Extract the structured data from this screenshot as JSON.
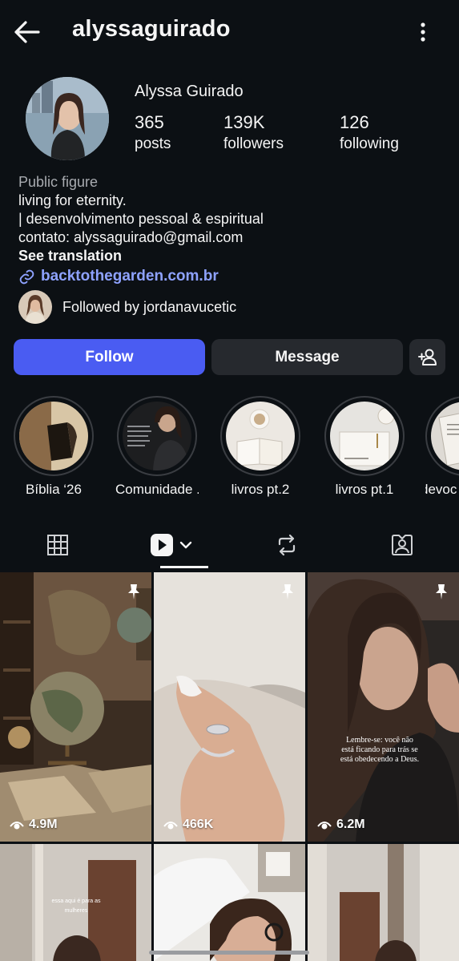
{
  "header": {
    "username": "alyssaguirado",
    "back_icon": "arrow-left-icon",
    "more_icon": "more-vertical-icon"
  },
  "profile": {
    "display_name": "Alyssa Guirado",
    "stats": [
      {
        "value": "365",
        "label": "posts"
      },
      {
        "value": "139K",
        "label": "followers"
      },
      {
        "value": "126",
        "label": "following"
      }
    ],
    "category": "Public figure",
    "bio_line1": "living for eternity.",
    "bio_line2": "| desenvolvimento pessoal & espiritual",
    "bio_line3": "contato: alyssaguirado@gmail.com",
    "see_translation": "See translation",
    "link": "backtothegarden.com.br",
    "followed_by": "Followed by jordanavucetic"
  },
  "actions": {
    "follow": "Follow",
    "message": "Message",
    "add_icon": "person-add-icon"
  },
  "highlights": [
    {
      "label": "Bíblia ‘26"
    },
    {
      "label": "Comunidade ..."
    },
    {
      "label": "livros pt.2"
    },
    {
      "label": "livros pt.1"
    },
    {
      "label": "devoc"
    }
  ],
  "tabs": [
    {
      "icon": "grid-icon"
    },
    {
      "icon": "reels-icon"
    },
    {
      "icon": "repost-icon"
    },
    {
      "icon": "tagged-icon"
    }
  ],
  "posts": [
    {
      "views": "4.9M",
      "pinned": true
    },
    {
      "views": "466K",
      "pinned": true
    },
    {
      "views": "6.2M",
      "pinned": true,
      "overlay": "Lembre-se: você não está ficando para trás se está obedecendo a Deus."
    },
    {
      "overlay": "essa aqui é para as mulheres"
    },
    {},
    {}
  ],
  "colors": {
    "background": "#0c1014",
    "follow_button": "#4a5cf2",
    "link": "#8ea2ff"
  }
}
